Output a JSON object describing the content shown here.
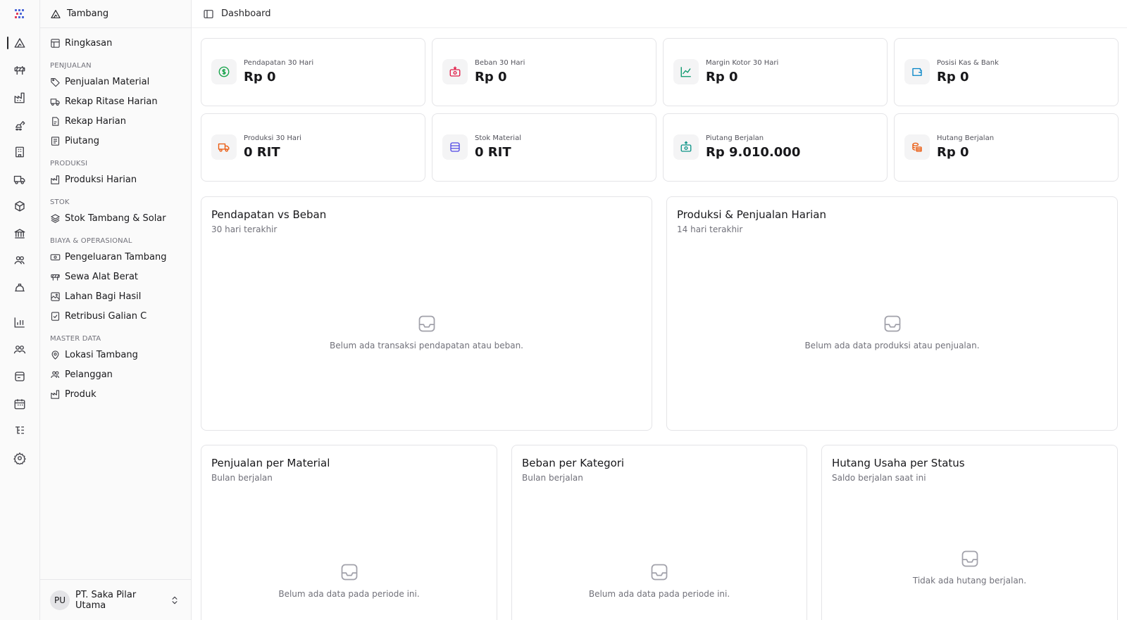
{
  "app": {
    "workspace": "Tambang",
    "breadcrumb": "Dashboard"
  },
  "sidebar": {
    "top_item": "Ringkasan",
    "groups": [
      {
        "title": "PENJUALAN",
        "items": [
          "Penjualan Material",
          "Rekap Ritase Harian",
          "Rekap Harian",
          "Piutang"
        ]
      },
      {
        "title": "PRODUKSI",
        "items": [
          "Produksi Harian"
        ]
      },
      {
        "title": "STOK",
        "items": [
          "Stok Tambang & Solar"
        ]
      },
      {
        "title": "BIAYA & OPERASIONAL",
        "items": [
          "Pengeluaran Tambang",
          "Sewa Alat Berat",
          "Lahan Bagi Hasil",
          "Retribusi Galian C"
        ]
      },
      {
        "title": "MASTER DATA",
        "items": [
          "Lokasi Tambang",
          "Pelanggan",
          "Produk"
        ]
      }
    ],
    "footer": {
      "initials": "PU",
      "org": "PT. Saka Pilar Utama"
    }
  },
  "rail": {
    "icons": [
      "mountain-icon",
      "barrier-icon",
      "factory-icon",
      "excavator-icon",
      "building-icon",
      "truck-icon",
      "package-icon",
      "bank-icon",
      "users-icon",
      "hard-hat-icon",
      "bar-chart-icon",
      "team-icon",
      "store-icon",
      "calendar-icon",
      "list-tree-icon",
      "settings-icon"
    ]
  },
  "stats": [
    {
      "label": "Pendapatan 30 Hari",
      "value": "Rp 0",
      "icon": "dollar-circle-icon",
      "color": "#16a34a"
    },
    {
      "label": "Beban 30 Hari",
      "value": "Rp 0",
      "icon": "money-out-icon",
      "color": "#e11d48"
    },
    {
      "label": "Margin Kotor 30 Hari",
      "value": "Rp 0",
      "icon": "trend-up-icon",
      "color": "#059669"
    },
    {
      "label": "Posisi Kas & Bank",
      "value": "Rp 0",
      "icon": "wallet-icon",
      "color": "#0284c7"
    },
    {
      "label": "Produksi 30 Hari",
      "value": "0 RIT",
      "icon": "truck-icon",
      "color": "#ea580c"
    },
    {
      "label": "Stok Material",
      "value": "0 RIT",
      "icon": "layers-icon",
      "color": "#4f46e5"
    },
    {
      "label": "Piutang Berjalan",
      "value": "Rp 9.010.000",
      "icon": "money-in-icon",
      "color": "#0d9488"
    },
    {
      "label": "Hutang Berjalan",
      "value": "Rp 0",
      "icon": "coins-icon",
      "color": "#ea580c"
    }
  ],
  "charts": [
    {
      "title": "Pendapatan vs Beban",
      "subtitle": "30 hari terakhir",
      "empty": "Belum ada transaksi pendapatan atau beban."
    },
    {
      "title": "Produksi & Penjualan Harian",
      "subtitle": "14 hari terakhir",
      "empty": "Belum ada data produksi atau penjualan."
    },
    {
      "title": "Penjualan per Material",
      "subtitle": "Bulan berjalan",
      "empty": "Belum ada data pada periode ini."
    },
    {
      "title": "Beban per Kategori",
      "subtitle": "Bulan berjalan",
      "empty": "Belum ada data pada periode ini."
    },
    {
      "title": "Hutang Usaha per Status",
      "subtitle": "Saldo berjalan saat ini",
      "empty": "Tidak ada hutang berjalan."
    }
  ]
}
